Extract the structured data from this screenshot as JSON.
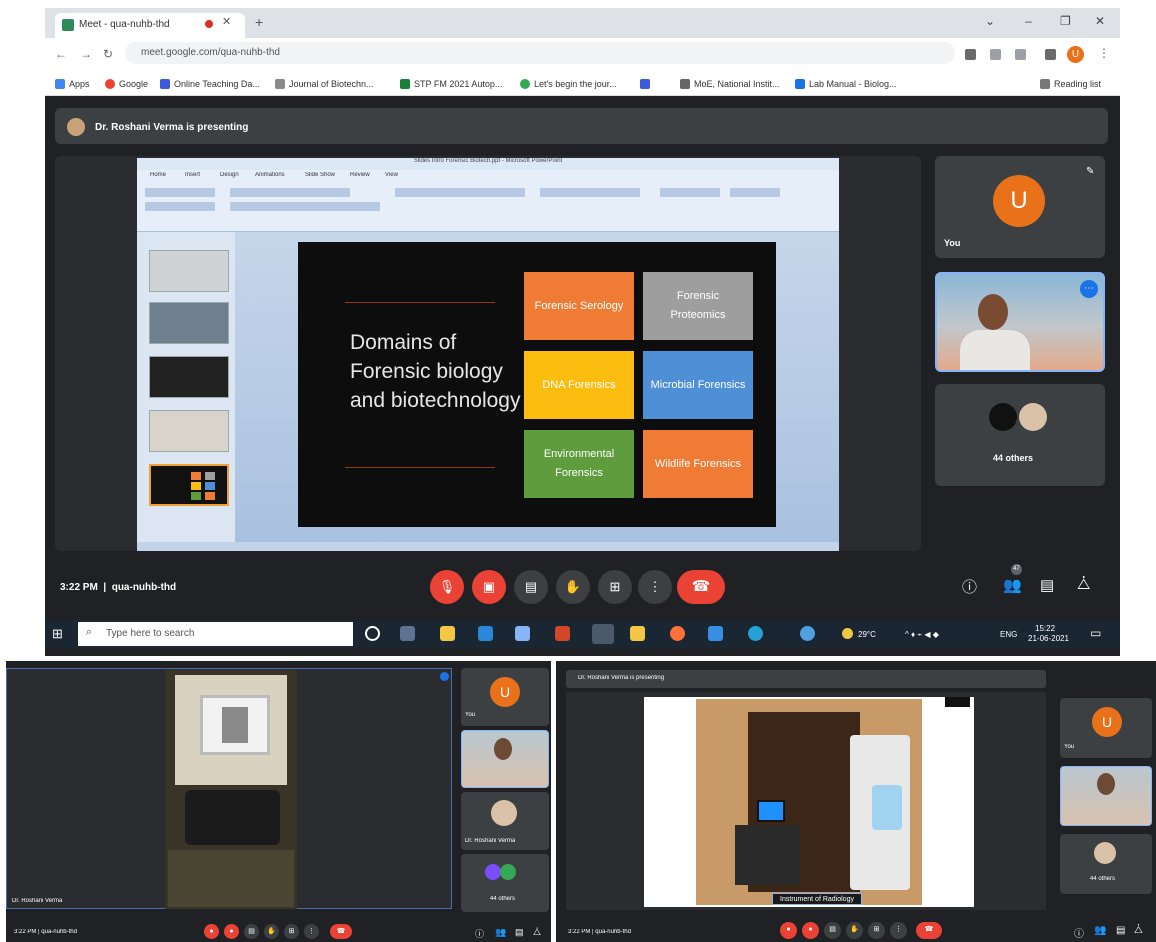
{
  "browser": {
    "tab_title": "Meet - qua-nuhb-thd",
    "url": "meet.google.com/qua-nuhb-thd",
    "profile_initial": "U",
    "bookmarks": [
      "Apps",
      "Google",
      "Online Teaching Da...",
      "Journal of Biotechn...",
      "STP FM 2021 Autop...",
      "Let's begin the jour...",
      "",
      "MoE, National Instit...",
      "Lab Manual - Biolog..."
    ],
    "reading_list": "Reading list"
  },
  "meet": {
    "presenting_text": "Dr. Roshani Verma is presenting",
    "clock": "3:22 PM",
    "meeting_code": "qua-nuhb-thd",
    "self_label": "You",
    "self_initial": "U",
    "others_label": "44 others",
    "people_count": "47",
    "accent_color": "#e8711a"
  },
  "ppt": {
    "window_title": "Slides Intro Forensic Biotech.ppt - Microsoft PowerPoint",
    "tabs": [
      "Home",
      "Insert",
      "Design",
      "Animations",
      "Slide Show",
      "Review",
      "View"
    ],
    "slide_title": "Domains of Forensic biology and biotechnology",
    "boxes": [
      {
        "label": "Forensic Serology",
        "color": "#f07b35"
      },
      {
        "label": "Forensic Proteomics",
        "color": "#9e9e9e"
      },
      {
        "label": "DNA Forensics",
        "color": "#fcbd11"
      },
      {
        "label": "Microbial Forensics",
        "color": "#4f8fd6"
      },
      {
        "label": "Environmental Forensics",
        "color": "#5e9c3d"
      },
      {
        "label": "Wildlife Forensics",
        "color": "#f07b35"
      }
    ]
  },
  "taskbar": {
    "search_placeholder": "Type here to search",
    "weather": "29°C",
    "time": "15:22",
    "date": "21-06-2021",
    "lang": "ENG"
  },
  "bottom_left": {
    "clock": "3:22 PM",
    "code": "qua-nuhb-thd",
    "presenter": "Dr. Roshani Verma",
    "self_label": "You",
    "self_initial": "U",
    "others_label": "44 others"
  },
  "bottom_right": {
    "presenter_bar": "Dr. Roshani Verma is presenting",
    "caption": "Instrument of Radiology",
    "clock": "3:22 PM",
    "code": "qua-nuhb-thd",
    "self_label": "You",
    "self_initial": "U",
    "others_label": "44 others"
  }
}
